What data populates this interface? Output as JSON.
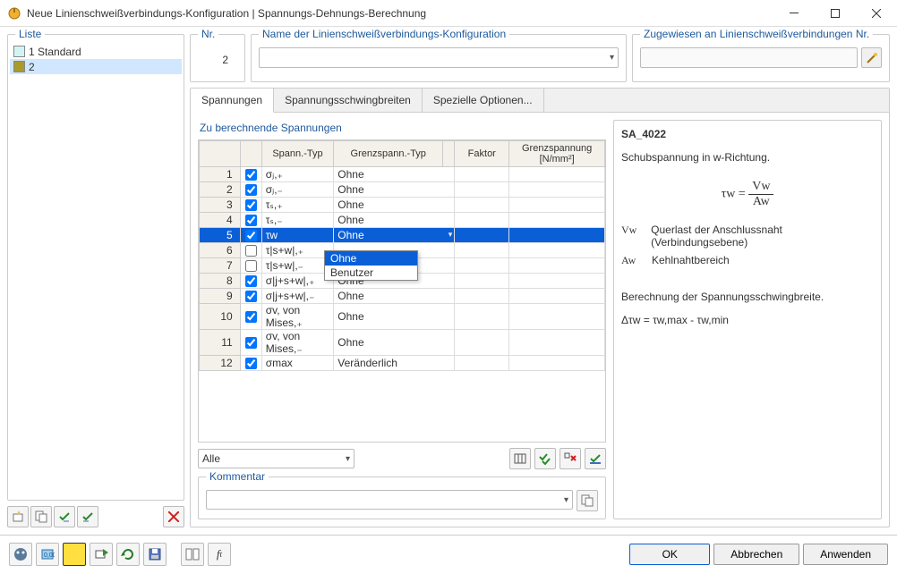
{
  "window": {
    "title": "Neue Linienschweißverbindungs-Konfiguration | Spannungs-Dehnungs-Berechnung"
  },
  "left": {
    "header": "Liste",
    "items": [
      {
        "label": "1  Standard",
        "color": "#d2f3f3",
        "selected": false
      },
      {
        "label": "2",
        "color": "#a89a2c",
        "selected": true
      }
    ]
  },
  "top": {
    "nr_label": "Nr.",
    "nr_value": "2",
    "name_label": "Name der Linienschweißverbindungs-Konfiguration",
    "assign_label": "Zugewiesen an Linienschweißverbindungen Nr."
  },
  "tabs": [
    {
      "label": "Spannungen",
      "active": true
    },
    {
      "label": "Spannungsschwingbreiten",
      "active": false
    },
    {
      "label": "Spezielle Optionen...",
      "active": false
    }
  ],
  "grid": {
    "title": "Zu berechnende Spannungen",
    "headers": {
      "spanntype": "Spann.-Typ",
      "grenztype": "Grenzspann.-Typ",
      "faktor": "Faktor",
      "grenzspannung": "Grenzspannung [N/mm²]"
    },
    "rows": [
      {
        "n": "1",
        "chk": true,
        "type": "σⱼ,₊",
        "grenz": "Ohne",
        "sel": false
      },
      {
        "n": "2",
        "chk": true,
        "type": "σⱼ,₋",
        "grenz": "Ohne",
        "sel": false
      },
      {
        "n": "3",
        "chk": true,
        "type": "τₛ,₊",
        "grenz": "Ohne",
        "sel": false
      },
      {
        "n": "4",
        "chk": true,
        "type": "τₛ,₋",
        "grenz": "Ohne",
        "sel": false
      },
      {
        "n": "5",
        "chk": true,
        "type": "τw",
        "grenz": "Ohne",
        "sel": true
      },
      {
        "n": "6",
        "chk": false,
        "type": "τ|s+w|,₊",
        "grenz": "",
        "sel": false
      },
      {
        "n": "7",
        "chk": false,
        "type": "τ|s+w|,₋",
        "grenz": "",
        "sel": false
      },
      {
        "n": "8",
        "chk": true,
        "type": "σ|j+s+w|,₊",
        "grenz": "Ohne",
        "sel": false
      },
      {
        "n": "9",
        "chk": true,
        "type": "σ|j+s+w|,₋",
        "grenz": "Ohne",
        "sel": false
      },
      {
        "n": "10",
        "chk": true,
        "type": "σv, von Mises,₊",
        "grenz": "Ohne",
        "sel": false
      },
      {
        "n": "11",
        "chk": true,
        "type": "σv, von Mises,₋",
        "grenz": "Ohne",
        "sel": false
      },
      {
        "n": "12",
        "chk": true,
        "type": "σmax",
        "grenz": "Veränderlich",
        "sel": false
      }
    ],
    "dropdown": {
      "options": [
        {
          "label": "Ohne",
          "selected": true
        },
        {
          "label": "Benutzer",
          "selected": false
        }
      ]
    },
    "bottom_combo": "Alle"
  },
  "comment": {
    "label": "Kommentar"
  },
  "info": {
    "code": "SA_4022",
    "desc": "Schubspannung in w-Richtung.",
    "formula_lhs": "τw =",
    "formula_num": "Vw",
    "formula_den": "Aw",
    "vars": [
      {
        "sym": "Vw",
        "txt": "Querlast der Anschlussnaht (Verbindungsebene)"
      },
      {
        "sym": "Aw",
        "txt": "Kehlnahtbereich"
      }
    ],
    "calc_title": "Berechnung der Spannungsschwingbreite.",
    "calc_formula": "Δτw = τw,max - τw,min"
  },
  "buttons": {
    "ok": "OK",
    "cancel": "Abbrechen",
    "apply": "Anwenden"
  }
}
